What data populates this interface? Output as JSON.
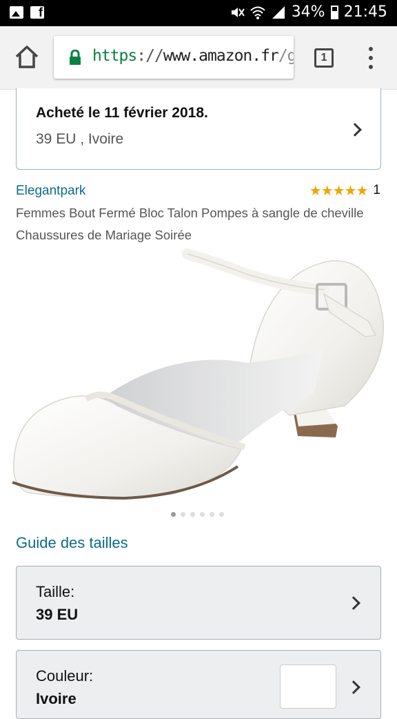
{
  "status_bar": {
    "battery": "34%",
    "time": "21:45",
    "app_icons": [
      "gallery-icon",
      "facebook-icon"
    ],
    "fb_glyph": "f"
  },
  "browser": {
    "url_scheme": "https",
    "url_separator": "://",
    "url_host": "www.amazon.fr",
    "url_path": "/g",
    "tab_count": "1"
  },
  "order": {
    "title": "Acheté le 11 février 2018.",
    "details": "39 EU , Ivoire"
  },
  "product": {
    "brand": "Elegantpark",
    "stars": "★★★★★",
    "rating_count": "1",
    "title": "Femmes Bout Fermé Bloc Talon Pompes à sangle de cheville Chaussures de Mariage Soirée",
    "image_count": 6,
    "active_image": 0
  },
  "size_guide": "Guide des tailles",
  "size_selector": {
    "label": "Taille:",
    "value": "39 EU"
  },
  "color_selector": {
    "label": "Couleur:",
    "value": "Ivoire",
    "swatch_color": "#ffffff"
  },
  "colors": {
    "link": "#0e6a8c",
    "secure": "#0b8043",
    "star": "#f0a500"
  }
}
